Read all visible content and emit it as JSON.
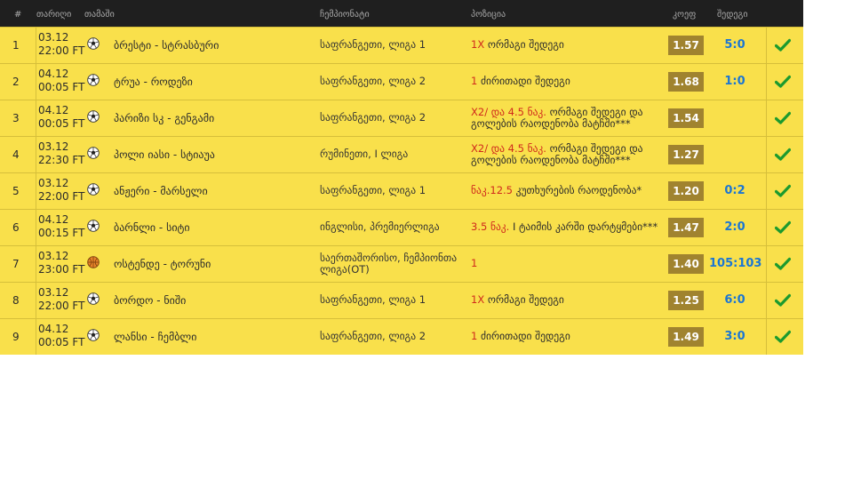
{
  "header": {
    "num": "#",
    "date": "თარიღი",
    "match": "თამაში",
    "championship": "ჩემპიონატი",
    "position": "პოზიცია",
    "coef": "კოეფ",
    "result": "შედეგი"
  },
  "rows": [
    {
      "num": "1",
      "date": "03.12",
      "time": "22:00 FT",
      "sport": "soccer-ball-icon",
      "match": "ბრესტი - სტრასბური",
      "champ": "საფრანგეთი, ლიგა 1",
      "pos_red": "1X",
      "pos_text": " ორმაგი შედეგი",
      "coef": "1.57",
      "score": "5:0"
    },
    {
      "num": "2",
      "date": "04.12",
      "time": "00:05 FT",
      "sport": "soccer-ball-icon",
      "match": "ტრუა - როდეზი",
      "champ": "საფრანგეთი, ლიგა 2",
      "pos_red": "1",
      "pos_text": " ძირითადი შედეგი",
      "coef": "1.68",
      "score": "1:0"
    },
    {
      "num": "3",
      "date": "04.12",
      "time": "00:05 FT",
      "sport": "soccer-ball-icon",
      "match": "პარიზი სკ - გენგამი",
      "champ": "საფრანგეთი, ლიგა 2",
      "pos_red": "X2/ და 4.5 ნაკ.",
      "pos_text": " ორმაგი შედეგი და გოლების რაოდენობა მატჩში***",
      "coef": "1.54",
      "score": ""
    },
    {
      "num": "4",
      "date": "03.12",
      "time": "22:30 FT",
      "sport": "soccer-ball-icon",
      "match": "პოლი იასი - სტიაუა",
      "champ": "რუმინეთი, I ლიგა",
      "pos_red": "X2/ და 4.5 ნაკ.",
      "pos_text": " ორმაგი შედეგი და გოლების რაოდენობა მატჩში***",
      "coef": "1.27",
      "score": ""
    },
    {
      "num": "5",
      "date": "03.12",
      "time": "22:00 FT",
      "sport": "soccer-ball-icon",
      "match": "ანჟერი - მარსელი",
      "champ": "საფრანგეთი, ლიგა 1",
      "pos_red": "ნაკ.12.5",
      "pos_text": " კუთხურების რაოდენობა*",
      "coef": "1.20",
      "score": "0:2"
    },
    {
      "num": "6",
      "date": "04.12",
      "time": "00:15 FT",
      "sport": "soccer-ball-icon",
      "match": "ბარნლი - სიტი",
      "champ": "ინგლისი, პრემიერლიგა",
      "pos_red": "3.5 ნაკ.",
      "pos_text": " I ტაიმის კარში დარტყმები***",
      "coef": "1.47",
      "score": "2:0"
    },
    {
      "num": "7",
      "date": "03.12",
      "time": "23:00 FT",
      "sport": "basketball-icon",
      "match": "ოსტენდე - ტორუნი",
      "champ": "საერთაშორისო, ჩემპიონთა ლიგა(OT)",
      "pos_red": "1",
      "pos_text": "",
      "coef": "1.40",
      "score": "105:103"
    },
    {
      "num": "8",
      "date": "03.12",
      "time": "22:00 FT",
      "sport": "soccer-ball-icon",
      "match": "ბორდო - ნიში",
      "champ": "საფრანგეთი, ლიგა 1",
      "pos_red": "1X",
      "pos_text": " ორმაგი შედეგი",
      "coef": "1.25",
      "score": "6:0"
    },
    {
      "num": "9",
      "date": "04.12",
      "time": "00:05 FT",
      "sport": "soccer-ball-icon",
      "match": "ლანსი - ჩემბლი",
      "champ": "საფრანგეთი, ლიგა 2",
      "pos_red": "1",
      "pos_text": " ძირითადი შედეგი",
      "coef": "1.49",
      "score": "3:0"
    }
  ],
  "colors": {
    "row_bg": "#f9e04b",
    "header_bg": "#1f1f1f",
    "coef_bg": "#a0832f",
    "score": "#1b76d3",
    "accent_red": "#d02a1c",
    "check": "#1c9a2e"
  }
}
